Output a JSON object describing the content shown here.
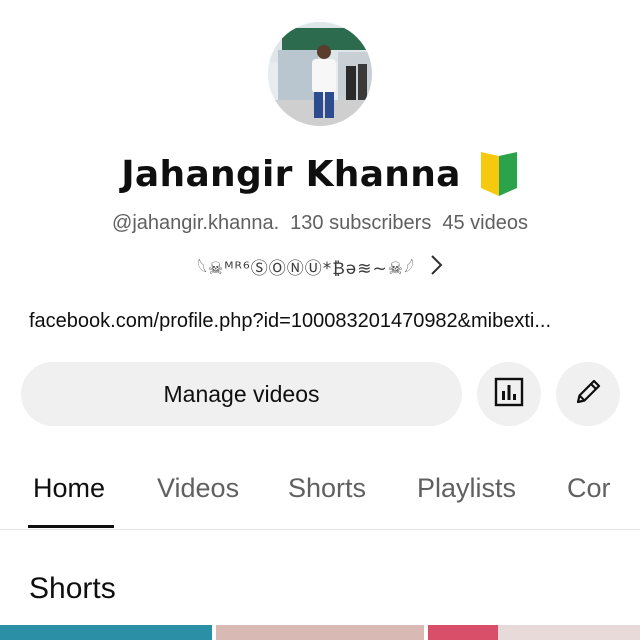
{
  "channel": {
    "name": "Jahangir Khanna",
    "handle": "@jahangir.khanna.",
    "subscribers": "130 subscribers",
    "videos": "45 videos",
    "description": "𓆩☠ᴹᴿ⁶ⓈⓄⓃⓊ*₿ə≋~☠𓆪",
    "link": "facebook.com/profile.php?id=100083201470982&mibexti..."
  },
  "actions": {
    "manage_label": "Manage videos",
    "analytics_icon": "analytics-icon",
    "edit_icon": "pencil-icon"
  },
  "tabs": [
    {
      "label": "Home",
      "active": true
    },
    {
      "label": "Videos",
      "active": false
    },
    {
      "label": "Shorts",
      "active": false
    },
    {
      "label": "Playlists",
      "active": false
    },
    {
      "label": "Cor",
      "active": false
    }
  ],
  "sections": {
    "shorts_title": "Shorts"
  },
  "colors": {
    "background": "#ffffff",
    "text_primary": "#0f0f0f",
    "text_secondary": "#606060",
    "button_bg": "#f0f0f0",
    "badge_green": "#2aa34a",
    "badge_yellow": "#f6c90e"
  }
}
